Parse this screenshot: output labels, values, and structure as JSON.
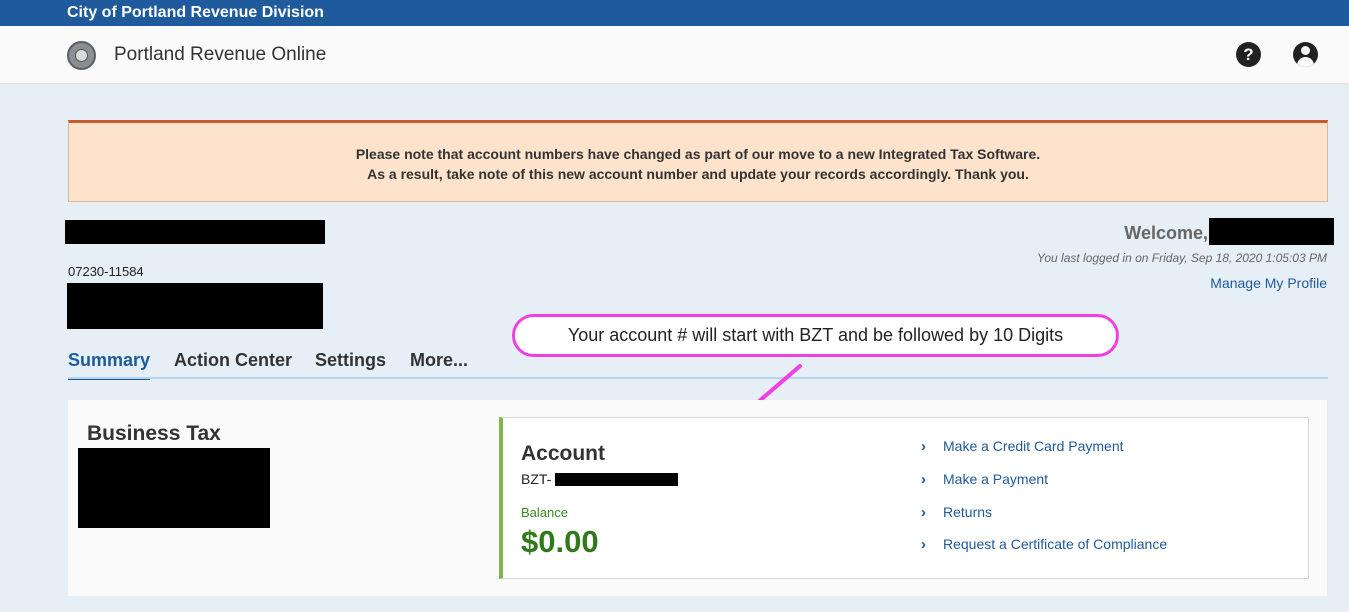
{
  "topbar": {
    "title": "City of Portland Revenue Division"
  },
  "header": {
    "title": "Portland Revenue Online",
    "icons": {
      "seal": "city-seal-icon",
      "help": "help-icon",
      "user": "user-account-icon"
    },
    "help_glyph": "?"
  },
  "notice": {
    "line1": "Please note that account numbers have changed as part of our move to a new Integrated Tax Software.",
    "line2": "As a result, take note of this new account number and update your records accordingly. Thank you."
  },
  "customer": {
    "account_number": "07230-11584"
  },
  "welcome": {
    "label": "Welcome,",
    "last_login": "You last logged in on Friday, Sep 18, 2020 1:05:03 PM",
    "manage_profile": "Manage My Profile"
  },
  "callout": {
    "text": "Your account # will start with BZT and be followed by 10 Digits",
    "color": "#f23fe5"
  },
  "tabs": [
    {
      "label": "Summary",
      "active": true
    },
    {
      "label": "Action Center",
      "active": false
    },
    {
      "label": "Settings",
      "active": false
    },
    {
      "label": "More...",
      "active": false
    }
  ],
  "panel": {
    "title": "Business Tax",
    "account": {
      "title": "Account",
      "prefix": "BZT-",
      "balance_label": "Balance",
      "balance_value": "$0.00"
    },
    "links": [
      {
        "label": "Make a Credit Card Payment",
        "icon": "chevron-right-icon",
        "glyph": "›"
      },
      {
        "label": "Make a Payment",
        "icon": "chevron-right-icon",
        "glyph": "›"
      },
      {
        "label": "Returns",
        "icon": "chevron-right-icon",
        "glyph": "›"
      },
      {
        "label": "Request a Certificate of Compliance",
        "icon": "chevron-right-icon",
        "glyph": "›"
      }
    ]
  },
  "colors": {
    "brand": "#1f5a9c",
    "notice_bg": "#fde3cc",
    "notice_border": "#c8592a",
    "balance": "#2f7a1a",
    "accent_bar": "#7fb54a"
  }
}
